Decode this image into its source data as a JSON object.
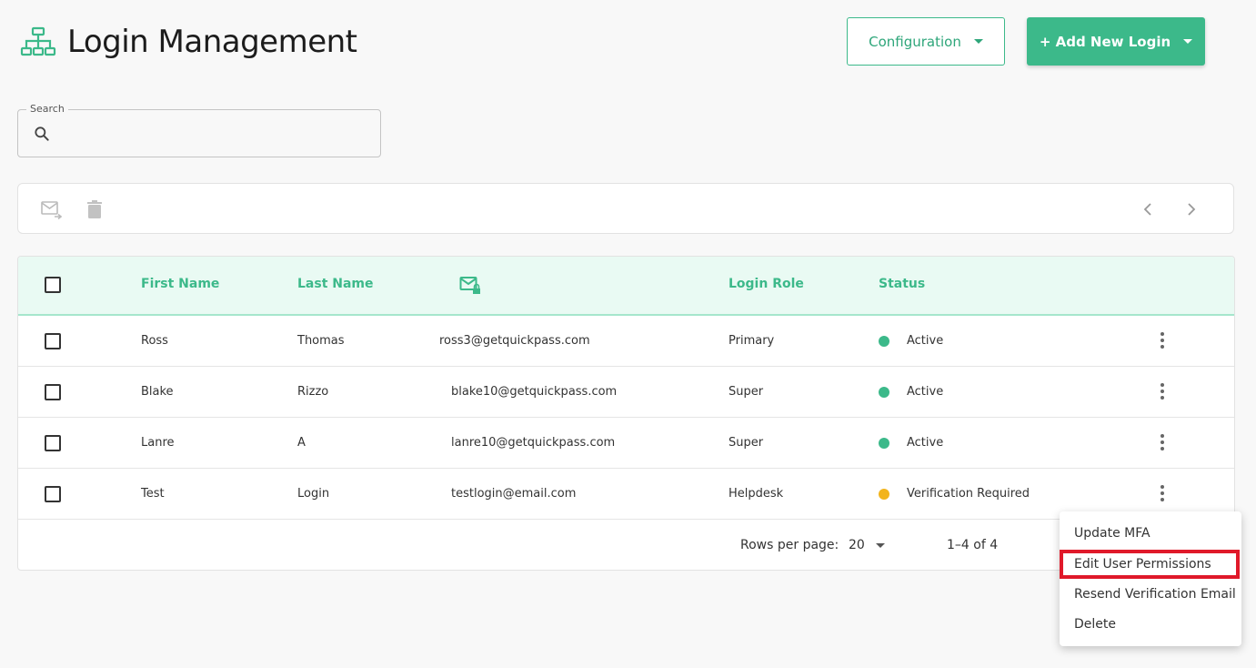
{
  "page": {
    "title": "Login Management"
  },
  "header": {
    "config_label": "Configuration",
    "add_label": "+ Add New Login"
  },
  "search": {
    "label": "Search",
    "value": "",
    "placeholder": ""
  },
  "toolbar": {
    "icons": [
      "mail-forward-icon",
      "trash-icon",
      "chevron-left-icon",
      "chevron-right-icon"
    ]
  },
  "table": {
    "headers": {
      "first_name": "First Name",
      "last_name": "Last Name",
      "email_icon": "mail-lock-icon",
      "role": "Login Role",
      "status": "Status"
    },
    "rows": [
      {
        "first": "Ross",
        "last": "Thomas",
        "email": "ross3@getquickpass.com",
        "role": "Primary",
        "status": "Active",
        "status_color": "#3cb98a"
      },
      {
        "first": "Blake",
        "last": "Rizzo",
        "email": "blake10@getquickpass.com",
        "role": "Super",
        "status": "Active",
        "status_color": "#3cb98a"
      },
      {
        "first": "Lanre",
        "last": "A",
        "email": "lanre10@getquickpass.com",
        "role": "Super",
        "status": "Active",
        "status_color": "#3cb98a"
      },
      {
        "first": "Test",
        "last": "Login",
        "email": "testlogin@email.com",
        "role": "Helpdesk",
        "status": "Verification Required",
        "status_color": "#f2b41c"
      }
    ]
  },
  "pagination": {
    "rows_label": "Rows per page:",
    "rows_value": "20",
    "range": "1–4 of 4"
  },
  "context_menu": {
    "items": [
      "Update MFA",
      "Edit User Permissions",
      "Resend Verification Email",
      "Delete"
    ],
    "highlight_color": "#e0192a"
  },
  "colors": {
    "accent": "#3cb98a",
    "header_bg": "#e9faf3"
  }
}
